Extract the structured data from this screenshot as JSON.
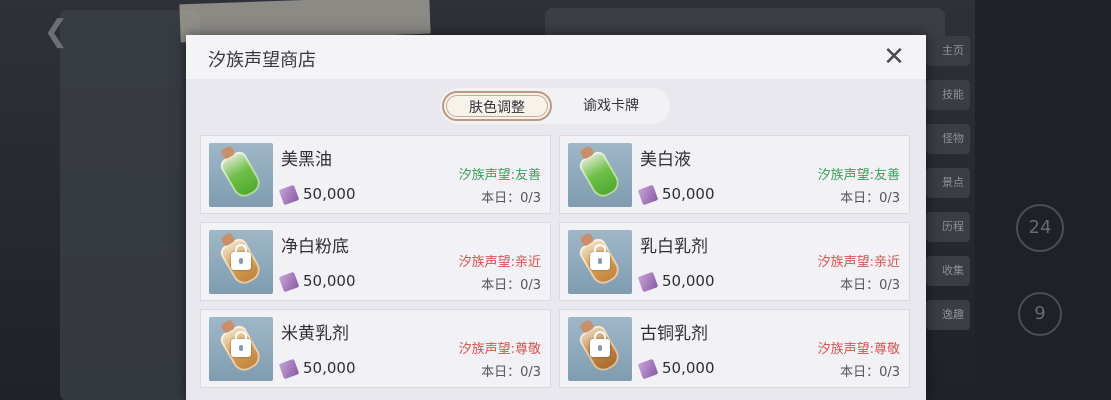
{
  "shop": {
    "title": "汐族声望商店",
    "close_icon": "close-icon",
    "tabs": [
      {
        "label": "肤色调整",
        "active": true
      },
      {
        "label": "谕戏卡牌",
        "active": false
      }
    ],
    "items": [
      {
        "name": "美黑油",
        "price": "50,000",
        "reputation": "汐族声望:友善",
        "rep_status": "friendly",
        "daily": "本日：0/3",
        "locked": false,
        "bottle": "green"
      },
      {
        "name": "美白液",
        "price": "50,000",
        "reputation": "汐族声望:友善",
        "rep_status": "friendly",
        "daily": "本日：0/3",
        "locked": false,
        "bottle": "green"
      },
      {
        "name": "净白粉底",
        "price": "50,000",
        "reputation": "汐族声望:亲近",
        "rep_status": "locked",
        "daily": "本日：0/3",
        "locked": true,
        "bottle": "amber"
      },
      {
        "name": "乳白乳剂",
        "price": "50,000",
        "reputation": "汐族声望:亲近",
        "rep_status": "locked",
        "daily": "本日：0/3",
        "locked": true,
        "bottle": "amber"
      },
      {
        "name": "米黄乳剂",
        "price": "50,000",
        "reputation": "汐族声望:尊敬",
        "rep_status": "locked",
        "daily": "本日：0/3",
        "locked": true,
        "bottle": "amber"
      },
      {
        "name": "古铜乳剂",
        "price": "50,000",
        "reputation": "汐族声望:尊敬",
        "rep_status": "locked",
        "daily": "本日：0/3",
        "locked": true,
        "bottle": "bronze"
      }
    ],
    "colors": {
      "friendly": "#3aa25a",
      "requirement": "#d9534f",
      "tab_border": "#b89a86"
    }
  },
  "background": {
    "side_nav": [
      "主页",
      "技能",
      "怪物",
      "景点",
      "历程",
      "收集",
      "逸趣"
    ],
    "circle_numbers": [
      "24",
      "9"
    ],
    "back_icon": "back-arrow-icon"
  }
}
